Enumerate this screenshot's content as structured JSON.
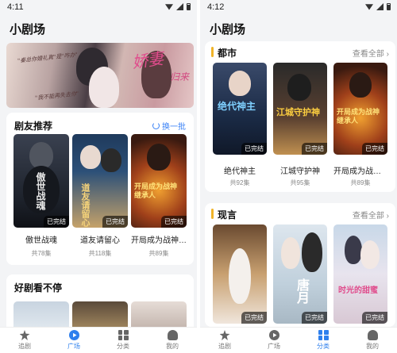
{
  "left": {
    "status_time": "4:11",
    "app_title": "小剧场",
    "banner": {
      "art_title": "娇妻",
      "art_subtitle": "归来",
      "quote_1": "\"秦总你婚礼真\"是\"咋办\"",
      "quote_2": "\"我不能再失去你\""
    },
    "recommend": {
      "title": "剧友推荐",
      "action_label": "换一批",
      "items": [
        {
          "name": "傲世战魂",
          "episodes": "共78集",
          "status": "已完结",
          "art": "傲世战魂"
        },
        {
          "name": "道友请留心",
          "episodes": "共118集",
          "status": "已完结",
          "art": "道友请留心"
        },
        {
          "name": "开局成为战神继...",
          "episodes": "共89集",
          "status": "已完结",
          "art": "开局成为战神继承人"
        }
      ]
    },
    "more": {
      "title": "好剧看不停"
    },
    "tabs": [
      {
        "label": "追剧",
        "icon": "star-icon"
      },
      {
        "label": "广场",
        "icon": "play-icon"
      },
      {
        "label": "分类",
        "icon": "grid-icon"
      },
      {
        "label": "我的",
        "icon": "user-icon"
      }
    ],
    "active_tab": "广场"
  },
  "right": {
    "status_time": "4:12",
    "app_title": "小剧场",
    "sections": [
      {
        "title": "都市",
        "more_label": "查看全部 ›",
        "items": [
          {
            "name": "绝代神主",
            "episodes": "共92集",
            "status": "已完结",
            "art": "绝代神主"
          },
          {
            "name": "江城守护神",
            "episodes": "共95集",
            "status": "已完结",
            "art": "江城守护神"
          },
          {
            "name": "开局成为战神...",
            "episodes": "共89集",
            "status": "已完结",
            "art": "开局成为战神继承人"
          }
        ]
      },
      {
        "title": "现言",
        "more_label": "查看全部 ›",
        "items": [
          {
            "status": "已完结",
            "art": ""
          },
          {
            "status": "已完结",
            "art": "唐月"
          },
          {
            "status": "已完结",
            "art": "时光的甜蜜"
          }
        ]
      }
    ],
    "tabs": [
      {
        "label": "追剧",
        "icon": "star-icon"
      },
      {
        "label": "广场",
        "icon": "play-icon"
      },
      {
        "label": "分类",
        "icon": "grid-icon"
      },
      {
        "label": "我的",
        "icon": "user-icon"
      }
    ],
    "active_tab": "分类"
  },
  "colors": {
    "accent": "#2f80ed",
    "section_bar": "#f0b429",
    "refresh": "#3b82f6"
  }
}
